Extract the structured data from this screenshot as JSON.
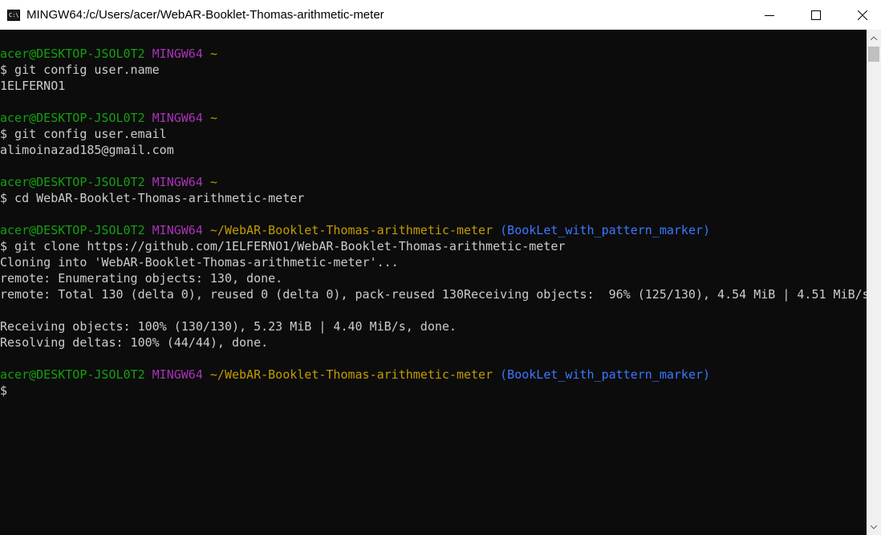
{
  "window": {
    "title": "MINGW64:/c/Users/acer/WebAR-Booklet-Thomas-arithmetic-meter",
    "app_icon_text": "C:\\",
    "icons": {
      "app": "terminal-app-icon",
      "minimize": "minimize-icon",
      "maximize": "maximize-icon",
      "close": "close-icon"
    }
  },
  "colors": {
    "background": "#0c0c0c",
    "text": "#cccccc",
    "user_host": "#13a10e",
    "system": "#a832b8",
    "path": "#c19c00",
    "branch": "#3b78ff"
  },
  "terminal": {
    "prompts": [
      {
        "user_host": "acer@DESKTOP-JSOL0T2",
        "system": "MINGW64",
        "path": "~",
        "branch": ""
      },
      {
        "user_host": "acer@DESKTOP-JSOL0T2",
        "system": "MINGW64",
        "path": "~",
        "branch": ""
      },
      {
        "user_host": "acer@DESKTOP-JSOL0T2",
        "system": "MINGW64",
        "path": "~",
        "branch": ""
      },
      {
        "user_host": "acer@DESKTOP-JSOL0T2",
        "system": "MINGW64",
        "path": "~/WebAR-Booklet-Thomas-arithmetic-meter",
        "branch": "(BookLet_with_pattern_marker)"
      },
      {
        "user_host": "acer@DESKTOP-JSOL0T2",
        "system": "MINGW64",
        "path": "~/WebAR-Booklet-Thomas-arithmetic-meter",
        "branch": "(BookLet_with_pattern_marker)"
      }
    ],
    "commands": [
      "$ git config user.name",
      "$ git config user.email",
      "$ cd WebAR-Booklet-Thomas-arithmetic-meter",
      "$ git clone https://github.com/1ELFERNO1/WebAR-Booklet-Thomas-arithmetic-meter",
      "$"
    ],
    "outputs": [
      "1ELFERNO1",
      "alimoinazad185@gmail.com",
      "Cloning into 'WebAR-Booklet-Thomas-arithmetic-meter'...",
      "remote: Enumerating objects: 130, done.",
      "remote: Total 130 (delta 0), reused 0 (delta 0), pack-reused 130Receiving objects:  96% (125/130), 4.54 MiB | 4.51 MiB/s",
      "Receiving objects: 100% (130/130), 5.23 MiB | 4.40 MiB/s, done.",
      "Resolving deltas: 100% (44/44), done."
    ]
  }
}
